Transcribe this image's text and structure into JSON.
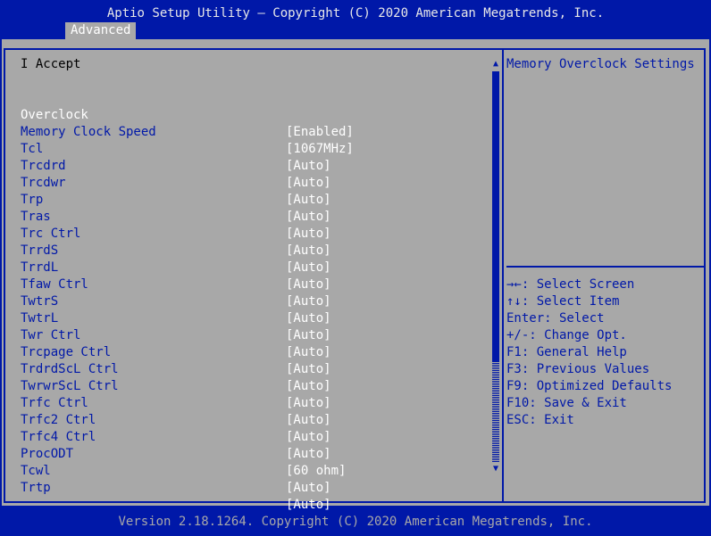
{
  "window": {
    "title": "Aptio Setup Utility – Copyright (C) 2020 American Megatrends, Inc.",
    "footer": "Version 2.18.1264. Copyright (C) 2020 American Megatrends, Inc."
  },
  "tabs": [
    {
      "label": "Advanced",
      "active": true
    }
  ],
  "main": {
    "header": "I Accept",
    "settings": [
      {
        "label": "Overclock",
        "value": "[Enabled]",
        "selected": true
      },
      {
        "label": "Memory Clock Speed",
        "value": "[1067MHz]"
      },
      {
        "label": "Tcl",
        "value": "[Auto]"
      },
      {
        "label": "Trcdrd",
        "value": "[Auto]"
      },
      {
        "label": "Trcdwr",
        "value": "[Auto]"
      },
      {
        "label": "Trp",
        "value": "[Auto]"
      },
      {
        "label": "Tras",
        "value": "[Auto]"
      },
      {
        "label": "Trc Ctrl",
        "value": "[Auto]"
      },
      {
        "label": "TrrdS",
        "value": "[Auto]"
      },
      {
        "label": "TrrdL",
        "value": "[Auto]"
      },
      {
        "label": "Tfaw Ctrl",
        "value": "[Auto]"
      },
      {
        "label": "TwtrS",
        "value": "[Auto]"
      },
      {
        "label": "TwtrL",
        "value": "[Auto]"
      },
      {
        "label": "Twr Ctrl",
        "value": "[Auto]"
      },
      {
        "label": "Trcpage Ctrl",
        "value": "[Auto]"
      },
      {
        "label": "TrdrdScL Ctrl",
        "value": "[Auto]"
      },
      {
        "label": "TwrwrScL Ctrl",
        "value": "[Auto]"
      },
      {
        "label": "Trfc Ctrl",
        "value": "[Auto]"
      },
      {
        "label": "Trfc2 Ctrl",
        "value": "[Auto]"
      },
      {
        "label": "Trfc4 Ctrl",
        "value": "[Auto]"
      },
      {
        "label": "ProcODT",
        "value": "[60 ohm]"
      },
      {
        "label": "Tcwl",
        "value": "[Auto]"
      },
      {
        "label": "Trtp",
        "value": "[Auto]"
      }
    ]
  },
  "help": {
    "title": "Memory Overclock Settings",
    "keys": [
      "→←: Select Screen",
      "↑↓: Select Item",
      "Enter: Select",
      "+/-: Change Opt.",
      "F1: General Help",
      "F3: Previous Values",
      "F9: Optimized Defaults",
      "F10: Save & Exit",
      "ESC: Exit"
    ]
  },
  "icons": {
    "scroll_up": "▲",
    "scroll_down": "▼"
  },
  "colors": {
    "background": "#0018a8",
    "panel": "#a8a8a8",
    "label": "#0018a8",
    "value": "#ffffff"
  }
}
